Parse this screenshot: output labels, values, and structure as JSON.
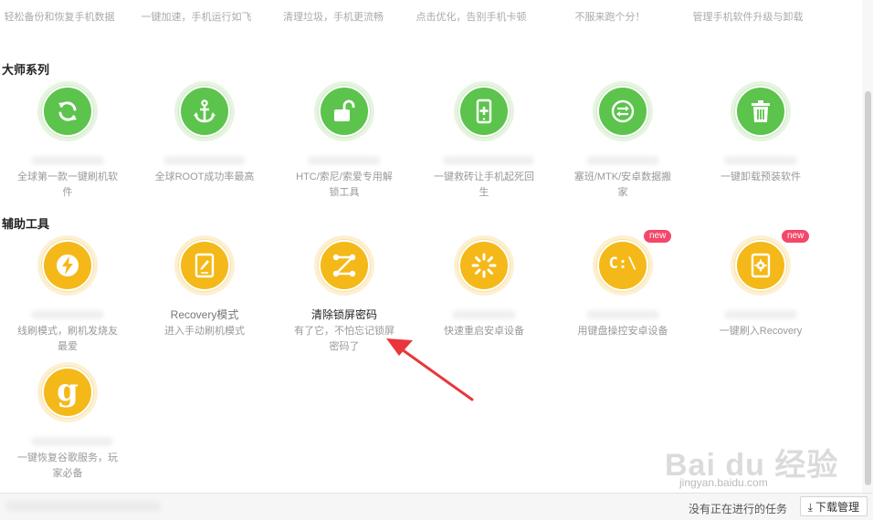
{
  "top_row": [
    {
      "desc": "轻松备份和恢复手机数据"
    },
    {
      "desc": "一键加速，手机运行如飞"
    },
    {
      "desc": "清理垃圾，手机更流畅"
    },
    {
      "desc": "点击优化，告别手机卡顿"
    },
    {
      "desc": "不服来跑个分！"
    },
    {
      "desc": "管理手机软件升级与卸载"
    }
  ],
  "sections": {
    "master": "大师系列",
    "assist": "辅助工具"
  },
  "master_tools": [
    {
      "icon": "refresh-icon",
      "name": "",
      "desc": "全球第一款一键刷机软件"
    },
    {
      "icon": "anchor-icon",
      "name": "",
      "desc": "全球ROOT成功率最高"
    },
    {
      "icon": "unlock-icon",
      "name": "",
      "desc": "HTC/索尼/索爱专用解锁工具"
    },
    {
      "icon": "phone-plus-icon",
      "name": "",
      "desc": "一键救砖让手机起死回生"
    },
    {
      "icon": "transfer-icon",
      "name": "",
      "desc": "塞班/MTK/安卓数据搬家"
    },
    {
      "icon": "trash-icon",
      "name": "",
      "desc": "一键卸载预装软件"
    }
  ],
  "assist_tools": [
    {
      "icon": "lightning-icon",
      "name": "",
      "desc": "线刷模式，刷机发烧友最爱",
      "badge": ""
    },
    {
      "icon": "tablet-pen-icon",
      "name": "Recovery模式",
      "desc": "进入手动刷机模式",
      "badge": ""
    },
    {
      "icon": "pattern-lock-icon",
      "name": "清除锁屏密码",
      "desc": "有了它，不怕忘记锁屏密码了",
      "badge": ""
    },
    {
      "icon": "restart-icon",
      "name": "",
      "desc": "快速重启安卓设备",
      "badge": ""
    },
    {
      "icon": "terminal-icon",
      "name": "",
      "desc": "用键盘操控安卓设备",
      "badge": "new"
    },
    {
      "icon": "phone-gear-icon",
      "name": "",
      "desc": "一键刷入Recovery",
      "badge": "new"
    }
  ],
  "extra_tools": [
    {
      "icon": "google-icon",
      "name": "",
      "desc": "一键恢复谷歌服务，玩家必备"
    }
  ],
  "icon_glyphs": {
    "terminal": "C:\\",
    "google": "g"
  },
  "bottom": {
    "status": "没有正在进行的任务",
    "download_label": "下载管理"
  },
  "watermark": {
    "brand": "Bai du 经验",
    "url": "jingyan.baidu.com"
  },
  "colors": {
    "green": "#5cc44c",
    "orange": "#f4b918",
    "badge": "#f4476a",
    "arrow": "#e8363c"
  }
}
